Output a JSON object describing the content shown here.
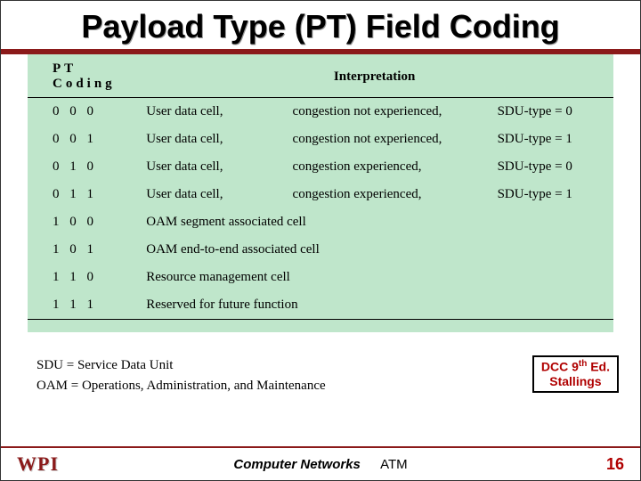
{
  "title": "Payload Type (PT) Field Coding",
  "table": {
    "headers": {
      "code": "PT Coding",
      "interp": "Interpretation"
    },
    "rows": [
      {
        "code": "0 0 0",
        "c1": "User data cell,",
        "c2": "congestion not experienced,",
        "c3": "SDU-type = 0"
      },
      {
        "code": "0 0 1",
        "c1": "User data cell,",
        "c2": "congestion not experienced,",
        "c3": "SDU-type = 1"
      },
      {
        "code": "0 1 0",
        "c1": "User data cell,",
        "c2": "congestion experienced,",
        "c3": "SDU-type = 0"
      },
      {
        "code": "0 1 1",
        "c1": "User data cell,",
        "c2": "congestion experienced,",
        "c3": "SDU-type = 1"
      },
      {
        "code": "1 0 0",
        "c1": "OAM segment associated cell",
        "c2": "",
        "c3": ""
      },
      {
        "code": "1 0 1",
        "c1": "OAM end-to-end associated cell",
        "c2": "",
        "c3": ""
      },
      {
        "code": "1 1 0",
        "c1": "Resource management cell",
        "c2": "",
        "c3": ""
      },
      {
        "code": "1 1 1",
        "c1": "Reserved for future function",
        "c2": "",
        "c3": ""
      }
    ]
  },
  "legend": {
    "sdu": "SDU  =  Service Data Unit",
    "oam": "OAM  =  Operations, Administration, and Maintenance"
  },
  "source": {
    "line1_pre": "DCC 9",
    "line1_sup": "th",
    "line1_post": " Ed.",
    "line2": "Stallings"
  },
  "footer": {
    "logo": "WPI",
    "course": "Computer Networks",
    "topic": "ATM",
    "page": "16"
  }
}
